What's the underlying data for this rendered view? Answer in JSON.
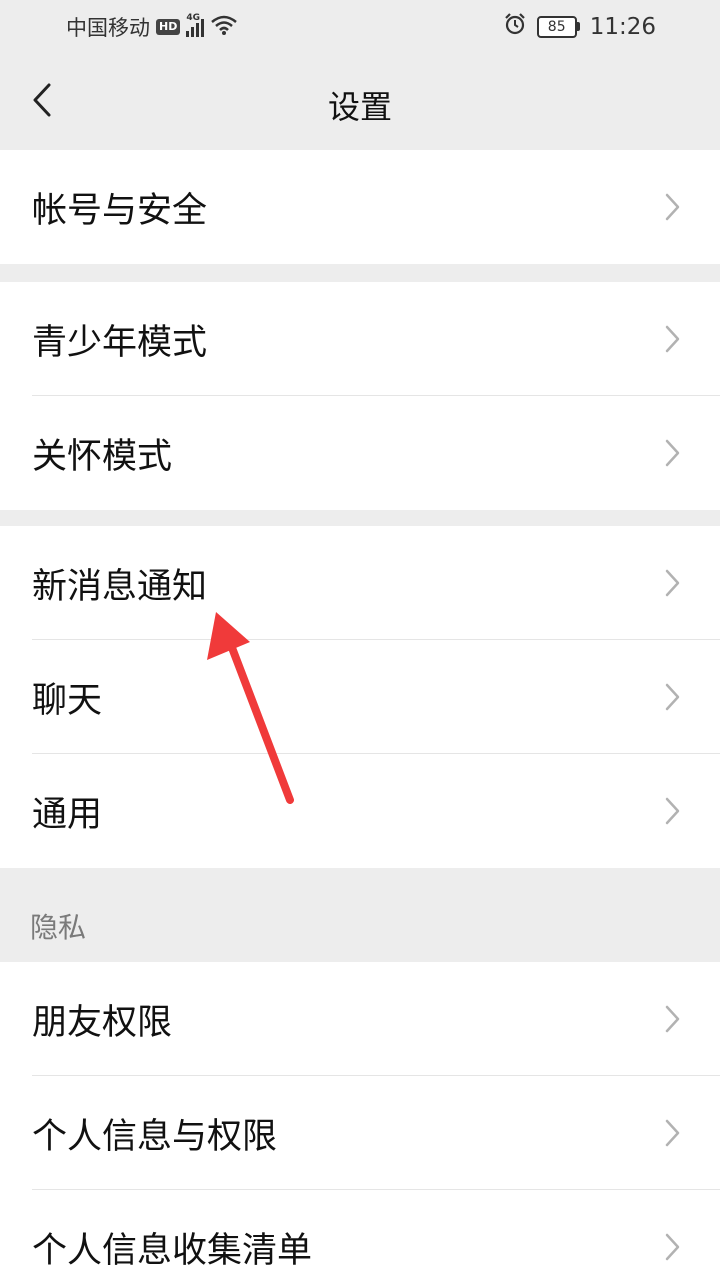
{
  "status_bar": {
    "carrier": "中国移动",
    "hd": "HD",
    "network": "4G",
    "battery": "85",
    "time": "11:26"
  },
  "nav": {
    "title": "设置"
  },
  "groups": [
    {
      "items": [
        {
          "label": "帐号与安全"
        }
      ]
    },
    {
      "items": [
        {
          "label": "青少年模式"
        },
        {
          "label": "关怀模式"
        }
      ]
    },
    {
      "items": [
        {
          "label": "新消息通知"
        },
        {
          "label": "聊天"
        },
        {
          "label": "通用"
        }
      ]
    },
    {
      "header": "隐私",
      "items": [
        {
          "label": "朋友权限"
        },
        {
          "label": "个人信息与权限"
        },
        {
          "label": "个人信息收集清单"
        }
      ]
    }
  ],
  "colors": {
    "background": "#ededed",
    "row_bg": "#ffffff",
    "annotation_arrow": "#f03a3a"
  }
}
